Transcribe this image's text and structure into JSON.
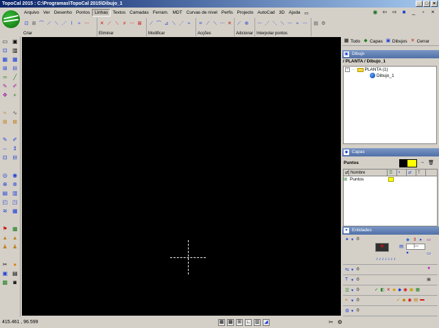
{
  "window": {
    "title": "TopoCal 2015 : C:\\Programas\\TopoCal 2015\\Dibujo_1",
    "buttons": [
      "_",
      "□",
      "×"
    ]
  },
  "menu": {
    "items": [
      "Arquivo",
      "Ver",
      "Desenho",
      "Pontos",
      "Linhas",
      "Textos",
      "Camadas",
      "Ferram.",
      "MDT",
      "Curvas de nível",
      "Perfis",
      "Projecto",
      "AutoCad",
      "3D",
      "Ajuda"
    ],
    "active": "Linhas",
    "right_icons": [
      "eye-icon",
      "arrow-icon",
      "arrow-icon",
      "help-icon",
      "minimize-icon",
      "restore-icon",
      "close-icon"
    ]
  },
  "ribbon": {
    "groups": [
      {
        "label": "Criar"
      },
      {
        "label": "Eliminar"
      },
      {
        "label": "Modificar"
      },
      {
        "label": "Acções"
      },
      {
        "label": "Adicionar"
      },
      {
        "label": "Interpolar pontos"
      }
    ]
  },
  "status": {
    "coords": "415.461 , 96.599"
  },
  "right_panel": {
    "tabs": [
      {
        "label": "Todo",
        "icon": "grid-icon"
      },
      {
        "label": "Capas",
        "icon": "layers-icon"
      },
      {
        "label": "Dibujos",
        "icon": "drawing-icon"
      },
      {
        "label": "Cerrar",
        "icon": "close-icon"
      }
    ],
    "dibujo_header": "Dibujo",
    "path": "/ PLANTA / Dibujo_1",
    "tree": {
      "root": "PLANTA (1)",
      "child": "Dibujo_1"
    },
    "capas_header": "Capas",
    "capas_current": "Puntos",
    "capas_table": {
      "columns": [
        "Nombre"
      ],
      "rows": [
        "Puntos"
      ]
    },
    "entidades_header": "Entidades",
    "entidades_values": [
      "0",
      "0",
      "0",
      "0",
      "0",
      "0"
    ]
  },
  "colors": {
    "titlebar_start": "#0a246a",
    "titlebar_end": "#a6caf0",
    "canvas": "#000000",
    "panel_header": "#5070a8",
    "layer_color": "#ffff00"
  }
}
